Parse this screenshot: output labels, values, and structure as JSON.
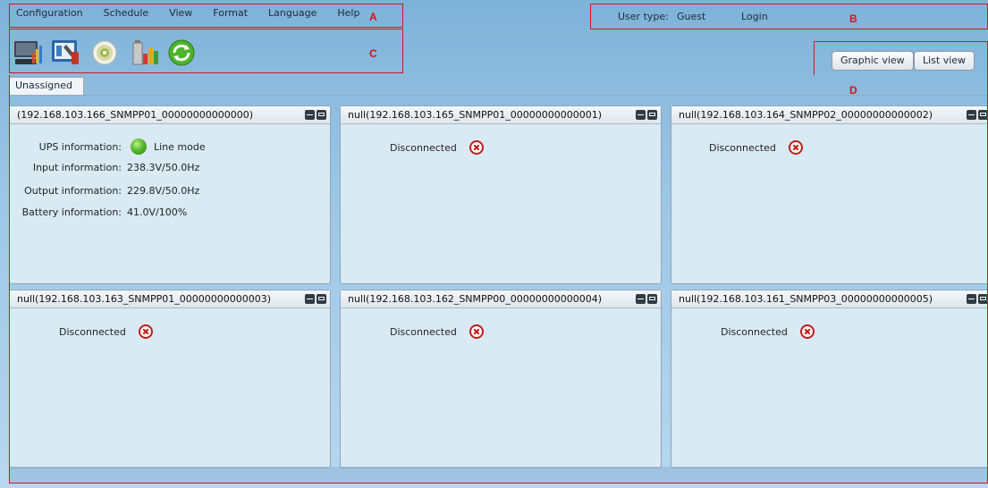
{
  "menu": {
    "items": [
      "Configuration",
      "Schedule",
      "View",
      "Format",
      "Language",
      "Help"
    ]
  },
  "user": {
    "type_label": "User type:",
    "type_value": "Guest",
    "login_label": "Login"
  },
  "toolbar": {
    "icons": [
      "monitor-icon",
      "tools-icon",
      "disc-icon",
      "battery-chart-icon",
      "refresh-icon"
    ]
  },
  "views": {
    "graphic_label": "Graphic view",
    "list_label": "List view"
  },
  "tabs": [
    {
      "label": "Unassigned"
    }
  ],
  "callouts": [
    "A",
    "B",
    "C",
    "D"
  ],
  "panels": [
    {
      "title": "(192.168.103.166_SNMPP01_00000000000000)",
      "rows": [
        {
          "label": "UPS information:",
          "value": "Line mode"
        },
        {
          "label": "Input information:",
          "value": "238.3V/50.0Hz"
        },
        {
          "label": "Output information:",
          "value": "229.8V/50.0Hz"
        },
        {
          "label": "Battery information:",
          "value": "41.0V/100%"
        }
      ]
    },
    {
      "title": "null(192.168.103.165_SNMPP01_00000000000001)",
      "status": "Disconnected"
    },
    {
      "title": "null(192.168.103.164_SNMPP02_00000000000002)",
      "status": "Disconnected"
    },
    {
      "title": "null(192.168.103.163_SNMPP01_00000000000003)",
      "status": "Disconnected"
    },
    {
      "title": "null(192.168.103.162_SNMPP00_00000000000004)",
      "status": "Disconnected"
    },
    {
      "title": "null(192.168.103.161_SNMPP03_00000000000005)",
      "status": "Disconnected"
    }
  ],
  "colors": {
    "callout": "#d21818",
    "status_ok": "#58b92d",
    "status_disconnected": "#c21a1a"
  }
}
